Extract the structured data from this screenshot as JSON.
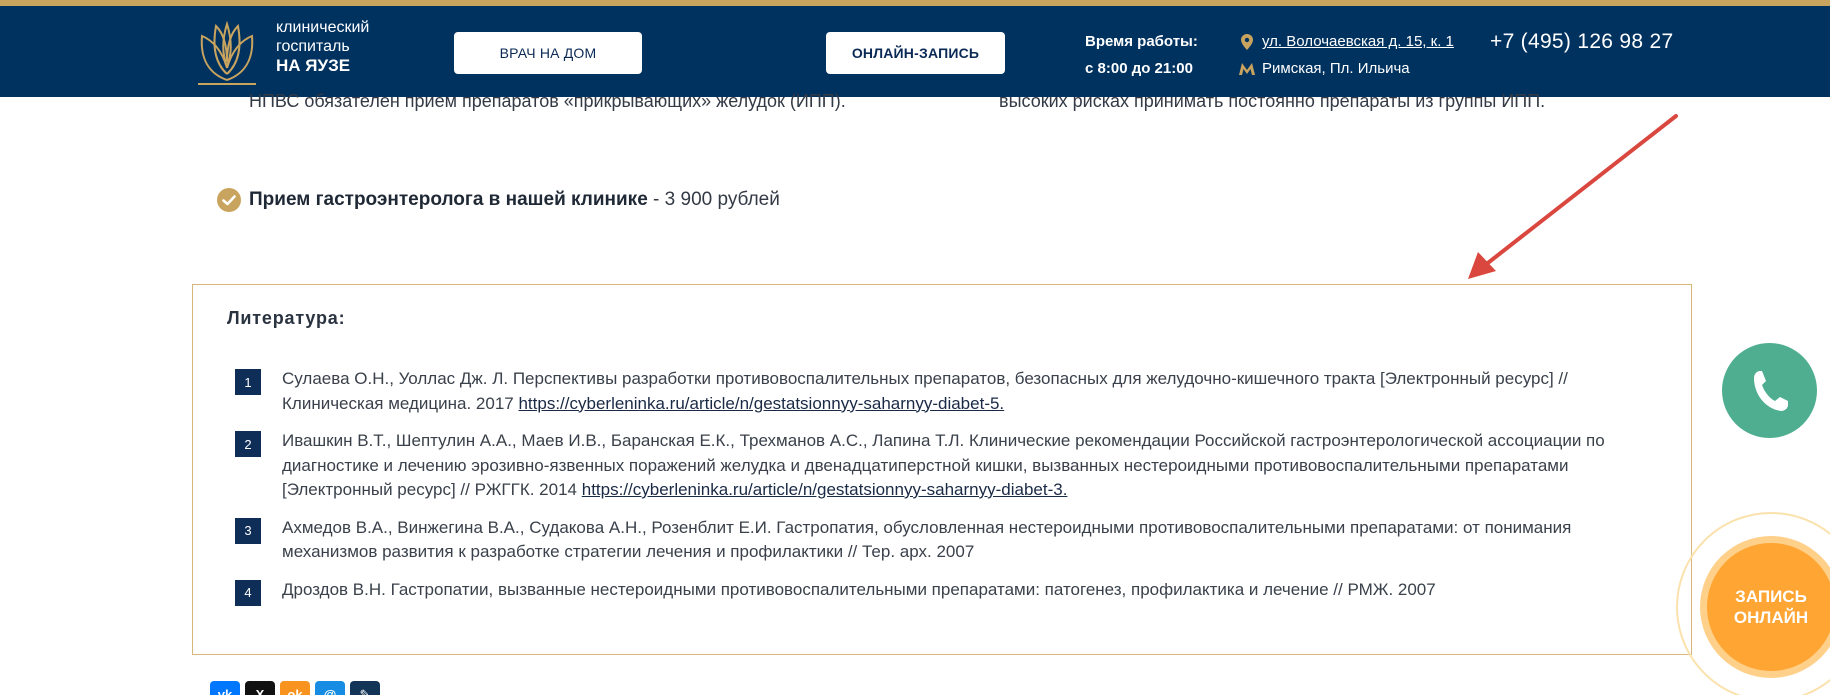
{
  "header": {
    "brand_line1": "клинический",
    "brand_line2": "госпиталь",
    "brand_line3": "НА ЯУЗЕ",
    "doctor_home_label": "ВРАЧ НА ДОМ",
    "online_booking_label": "ОНЛАЙН-ЗАПИСЬ",
    "work_hours_label": "Время работы:",
    "work_hours_value": "с 8:00 до 21:00",
    "address": "ул. Волочаевская д. 15, к. 1",
    "metro": "Римская, Пл. Ильича",
    "phone": "+7 (495) 126 98 27"
  },
  "content": {
    "cut_text_left": "НПВС обязателен прием препаратов «прикрывающих» желудок (ИПП).",
    "cut_text_right": "высоких рисках принимать постоянно препараты из группы ИПП.",
    "price_strong": "Прием гастроэнтеролога в нашей клинике",
    "price_rest": " - 3 900 рублей"
  },
  "literature": {
    "title": "Литература:",
    "items": [
      {
        "num": "1",
        "text": "Сулаева О.Н., Уоллас Дж. Л. Перспективы разработки противовоспалительных препаратов, безопасных для желудочно-кишечного тракта [Электронный ресурс] // Клиническая медицина. 2017 ",
        "link": "https://cyberleninka.ru/article/n/gestatsionnyy-saharnyy-diabet-5."
      },
      {
        "num": "2",
        "text": "Ивашкин В.Т., Шептулин А.А., Маев И.В., Баранская Е.К., Трехманов А.С., Лапина Т.Л. Клинические рекомендации Российской гастроэнтерологической ассоциации по диагностике и лечению эрозивно-язвенных поражений желудка и двенадцатиперстной кишки, вызванных нестероидными противовоспалительными препаратами [Электронный ресурс] // РЖГГК. 2014 ",
        "link": "https://cyberleninka.ru/article/n/gestatsionnyy-saharnyy-diabet-3."
      },
      {
        "num": "3",
        "text": "Ахмедов В.А., Винжегина В.А., Судакова А.Н., Розенблит Е.И. Гастропатия, обусловленная нестероидными противовоспалительными препаратами: от понимания механизмов развития к разработке стратегии лечения и профилактики // Тер. арх. 2007",
        "link": ""
      },
      {
        "num": "4",
        "text": "Дроздов В.Н. Гастропатии, вызванные нестероидными противовоспалительными препаратами: патогенез, профилактика и лечение // РМЖ. 2007",
        "link": ""
      }
    ]
  },
  "share": [
    {
      "icon": "vk-icon",
      "label": "vk",
      "color": "#0077ff"
    },
    {
      "icon": "x-icon",
      "label": "X",
      "color": "#111111"
    },
    {
      "icon": "ok-icon",
      "label": "ok",
      "color": "#f7931e"
    },
    {
      "icon": "moimir-icon",
      "label": "@",
      "color": "#168de2"
    },
    {
      "icon": "lj-icon",
      "label": "✎",
      "color": "#123456"
    }
  ],
  "floating": {
    "call_icon": "phone-icon",
    "booking_line1": "ЗАПИСЬ",
    "booking_line2": "ОНЛАЙН"
  },
  "colors": {
    "header_bg": "#003260",
    "accent_gold": "#c9a45f",
    "call_green": "#4fae8f",
    "booking_orange": "#ffa533",
    "annotation_red": "#d9473f"
  }
}
